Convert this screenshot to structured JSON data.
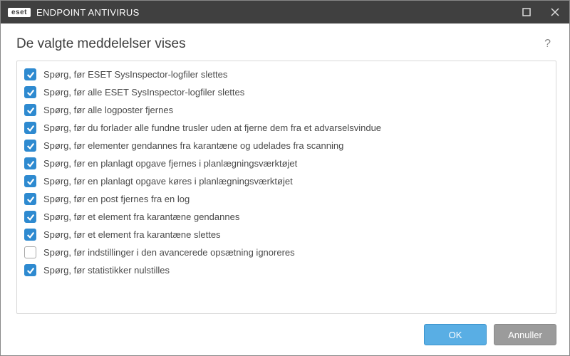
{
  "titlebar": {
    "brand": "eset",
    "product": "ENDPOINT ANTIVIRUS"
  },
  "header": {
    "title": "De valgte meddelelser vises",
    "help": "?"
  },
  "list": {
    "items": [
      {
        "checked": true,
        "label": "Spørg, før ESET SysInspector-logfiler slettes"
      },
      {
        "checked": true,
        "label": "Spørg, før alle ESET SysInspector-logfiler slettes"
      },
      {
        "checked": true,
        "label": "Spørg, før alle logposter fjernes"
      },
      {
        "checked": true,
        "label": "Spørg, før du forlader alle fundne trusler uden at fjerne dem fra et advarselsvindue"
      },
      {
        "checked": true,
        "label": "Spørg, før elementer gendannes fra karantæne og udelades fra scanning"
      },
      {
        "checked": true,
        "label": "Spørg, før en planlagt opgave fjernes i planlægningsværktøjet"
      },
      {
        "checked": true,
        "label": "Spørg, før en planlagt opgave køres i planlægningsværktøjet"
      },
      {
        "checked": true,
        "label": "Spørg, før en post fjernes fra en log"
      },
      {
        "checked": true,
        "label": "Spørg, før et element fra karantæne gendannes"
      },
      {
        "checked": true,
        "label": "Spørg, før et element fra karantæne slettes"
      },
      {
        "checked": false,
        "label": "Spørg, før indstillinger i den avancerede opsætning ignoreres"
      },
      {
        "checked": true,
        "label": "Spørg, før statistikker nulstilles"
      }
    ]
  },
  "footer": {
    "ok_label": "OK",
    "cancel_label": "Annuller"
  }
}
